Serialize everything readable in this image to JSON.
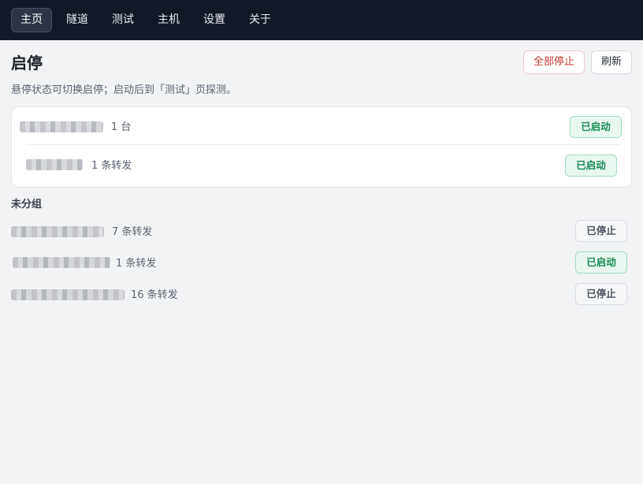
{
  "nav": {
    "tabs": [
      {
        "label": "主页",
        "active": true
      },
      {
        "label": "隧道",
        "active": false
      },
      {
        "label": "测试",
        "active": false
      },
      {
        "label": "主机",
        "active": false
      },
      {
        "label": "设置",
        "active": false
      },
      {
        "label": "关于",
        "active": false
      }
    ]
  },
  "header": {
    "title": "启停",
    "stop_all_label": "全部停止",
    "refresh_label": "刷新",
    "hint": "悬停状态可切换启停；启动后到「测试」页探测。"
  },
  "card": {
    "rows": [
      {
        "meta": "1 台",
        "status": "已启动",
        "running": true
      },
      {
        "meta": "1 条转发",
        "status": "已启动",
        "running": true
      }
    ]
  },
  "ungrouped": {
    "label": "未分组",
    "rows": [
      {
        "meta": "7 条转发",
        "status": "已停止",
        "running": false
      },
      {
        "meta": "1 条转发",
        "status": "已启动",
        "running": true
      },
      {
        "meta": "16 条转发",
        "status": "已停止",
        "running": false
      }
    ]
  },
  "colors": {
    "nav_bg": "#121826",
    "running": "#178a55",
    "stopped": "#4a505c",
    "danger": "#c0392b"
  }
}
